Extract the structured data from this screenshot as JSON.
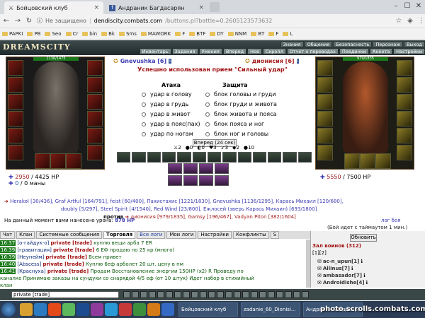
{
  "browser": {
    "tabs": [
      {
        "title": "Бойцовский клуб",
        "active": true
      },
      {
        "title": "Андраник Багдасарян",
        "active": false
      }
    ],
    "address": {
      "security": "Не защищено",
      "host": "dendiscity.combats.com",
      "path": "/buttons.pl?battle=0.2605123573632"
    },
    "bookmarks": [
      "PAPKI",
      "PB",
      "Seo",
      "Cr",
      "bin",
      "Bk",
      "Sms",
      "MAWORK",
      "F",
      "BTF",
      "DY",
      "NNM",
      "BT",
      "F",
      "L"
    ]
  },
  "game": {
    "logo": "DREAMSCITY",
    "top_menu": [
      "Знания",
      "Общение",
      "Безопасность",
      "Персонаж",
      "Выход"
    ],
    "sub_menu": [
      "Инвентарь",
      "Задания",
      "Умения",
      "Вперед",
      "Нов",
      "Скролл",
      "Отчет о переводах",
      "Поединки",
      "Анкета",
      "Настройки"
    ],
    "hp_left": "1136/1475",
    "hp_right": "979/1835",
    "player_left": {
      "name": "Gnevushka [6]"
    },
    "player_right": {
      "name": "дионисия [6]"
    },
    "message": "Успешно использован прием \"Сильный удар\"",
    "attack_title": "Атака",
    "defense_title": "Защита",
    "attack_options": [
      "удар в голову",
      "удар в грудь",
      "удар в живот",
      "удар в пояс(пах)",
      "удар по ногам"
    ],
    "defense_options": [
      "блок головы и груди",
      "блок груди и живота",
      "блок живота и пояса",
      "блок пояса и ног",
      "блок ног и головы"
    ],
    "forward_button": "Вперед (24 сек)",
    "counters": [
      "2",
      "0",
      "0",
      "3",
      "3",
      "2",
      "10"
    ],
    "stats_left": {
      "hp": "2950",
      "hp_max": "4425",
      "hp_unit": "HP",
      "mana": "0",
      "mana_max": "0",
      "mana_unit": "маны"
    },
    "stats_right": {
      "hp": "5550",
      "hp_max": "7500",
      "hp_unit": "HP"
    },
    "participants_line1": "Herakol [30/436], Graf Artful [164/791], feist [60/400], Пахистахис [1221/1830], Gnevushka [1136/1295], Карась Михаил [120/680],",
    "participants_line2": "doubly [5/297], Steel Spirit [4/1540], Red Wind [23/800], Ежлосей (зверь Карась Михаил) [693/1800]",
    "vs_label": "против",
    "participants_line3": "дионисия [979/1835], Gamsy [196/467], Vadyan Piton [382/1604]",
    "damage_label": "На данный момент вами нанесено урона:",
    "damage_value": "878 HP",
    "fight_log": "лог боя",
    "timeout": "(Бой идет с таймаутом 1 мин.)"
  },
  "chat": {
    "tabs": [
      "Чат",
      "Клан",
      "Системные сообщения",
      "Торговля",
      "Все логи",
      "Мои логи",
      "Настройки",
      "Конфликты",
      "S"
    ],
    "active_tab": "Торговля",
    "lines": [
      {
        "time": "16:37",
        "channel": "[о-гайдук-о]",
        "private": "private [trade]",
        "text": "куплю вещи арба 7 ER"
      },
      {
        "time": "16:39",
        "channel": "[гравитация]",
        "private": "private [trade]",
        "text": "6 EФ продаю по 25 кр (много)"
      },
      {
        "time": "16:39",
        "channel": "[Неунейм]",
        "private": "private [trade]",
        "text": "Всем привет"
      },
      {
        "time": "16:40",
        "channel": "[Abscess]",
        "private": "private [trade]",
        "text": "Куплю 6еф арболет 20 шт. цену в пм"
      },
      {
        "time": "16:41",
        "channel": "[Краснуха]",
        "private": "private [trade]",
        "text": "Продам Восстановление энергии 150HP (x2) R  Проведу по"
      },
      {
        "time": "",
        "channel": "",
        "private": "",
        "text": "каналке  Принимаю заказы на сундуки со снарядой 4/5 еф (от 10 штук)  Идет набор в стихийный"
      },
      {
        "time": "",
        "channel": "",
        "private": "",
        "text": "клан"
      }
    ],
    "input": "private [trade]"
  },
  "side": {
    "update_button": "Обновить",
    "hall": "Зал воинов (312)",
    "hall_sub": "[1][2]",
    "players": [
      "ac-n_upun[1]",
      "Allinus[7]",
      "ambasador[7]",
      "Androidishe[4]"
    ]
  },
  "taskbar": {
    "items": [
      "Бойцовский клуб",
      "zadanie_60_Dionisi...",
      "Андраник Багдасар..."
    ],
    "watermark": "photo.scrolls.combats.com"
  }
}
